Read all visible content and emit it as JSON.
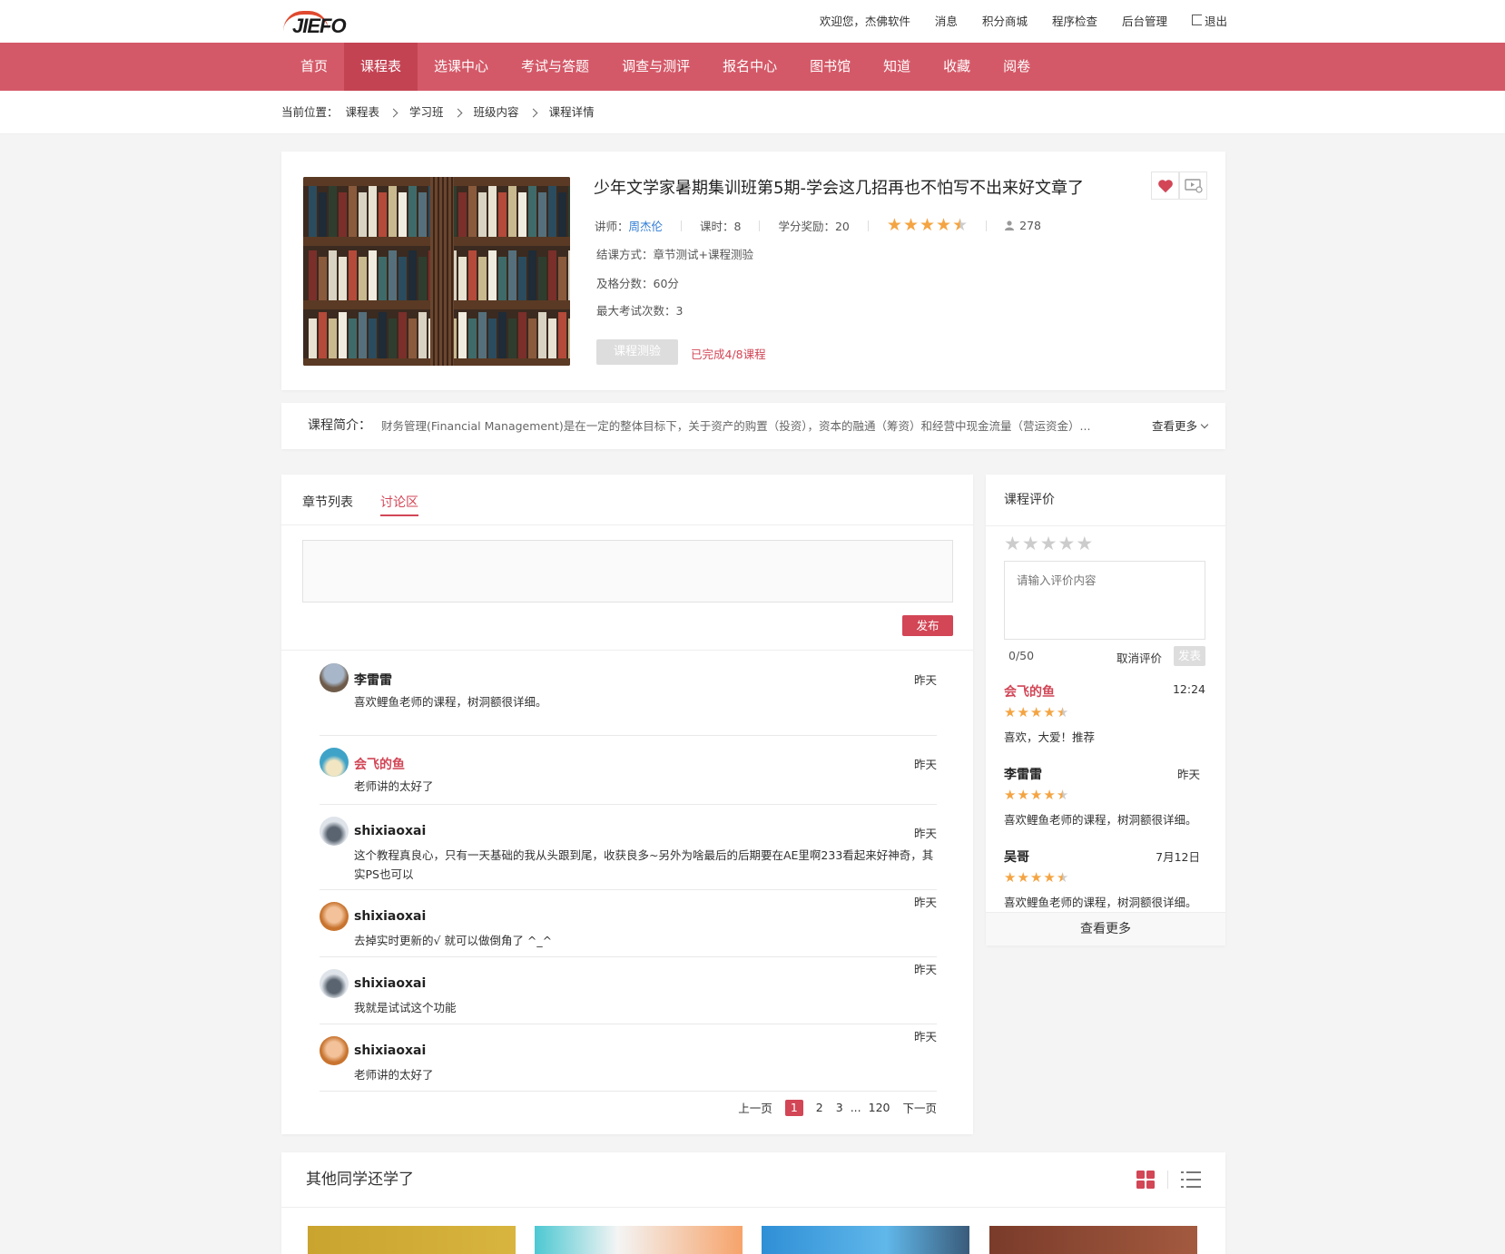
{
  "header": {
    "logo_text": "JIEFO",
    "welcome": "欢迎您，杰佛软件",
    "links": [
      "消息",
      "积分商城",
      "程序检查",
      "后台管理"
    ],
    "logout": "退出"
  },
  "nav": {
    "items": [
      "首页",
      "课程表",
      "选课中心",
      "考试与答题",
      "调查与测评",
      "报名中心",
      "图书馆",
      "知道",
      "收藏",
      "阅卷"
    ],
    "active_index": 1
  },
  "breadcrumb": {
    "label": "当前位置：",
    "items": [
      "课程表",
      "学习班",
      "班级内容",
      "课程详情"
    ]
  },
  "course": {
    "title": "少年文学家暑期集训班第5期-学会这几招再也不怕写不出来好文章了",
    "teacher_label": "讲师：",
    "teacher": "周杰伦",
    "hours": "课时：8",
    "credits": "学分奖励：20",
    "rating": 4.5,
    "learners": "278",
    "completion_mode": "结课方式：章节测试+课程测验",
    "pass_score": "及格分数：60分",
    "max_attempts": "最大考试次数：3",
    "test_button": "课程测验",
    "progress_text": "已完成4/8课程"
  },
  "intro": {
    "label": "课程简介：",
    "text": "财务管理(Financial Management)是在一定的整体目标下，关于资产的购置（投资），资本的融通（筹资）和经营中现金流量（营运资金）...",
    "more": "查看更多"
  },
  "discussion": {
    "tabs": [
      "章节列表",
      "讨论区"
    ],
    "active_tab": 1,
    "publish": "发布",
    "comments": [
      {
        "name": "李雷雷",
        "time": "昨天",
        "text": "喜欢鲤鱼老师的课程，树洞额很详细。",
        "highlight": false
      },
      {
        "name": "会飞的鱼",
        "time": "昨天",
        "text": "老师讲的太好了",
        "highlight": true
      },
      {
        "name": "shixiaoxai",
        "time": "昨天",
        "text": "这个教程真良心，只有一天基础的我从头跟到尾，收获良多~另外为啥最后的后期要在AE里啊233看起来好神奇，其实PS也可以",
        "highlight": false
      },
      {
        "name": "shixiaoxai",
        "time": "昨天",
        "text": "去掉实时更新的√ 就可以做倒角了 ^_^",
        "highlight": false
      },
      {
        "name": "shixiaoxai",
        "time": "昨天",
        "text": "我就是试试这个功能",
        "highlight": false
      },
      {
        "name": "shixiaoxai",
        "time": "昨天",
        "text": "老师讲的太好了",
        "highlight": false
      }
    ],
    "pager": {
      "prev": "上一页",
      "pages": [
        "1",
        "2",
        "3"
      ],
      "ellipsis": "...",
      "last": "120",
      "next": "下一页",
      "current": "1"
    }
  },
  "review": {
    "title": "课程评价",
    "placeholder": "请输入评价内容",
    "count": "0/50",
    "cancel": "取消评价",
    "submit": "发表",
    "items": [
      {
        "name": "会飞的鱼",
        "time": "12:24",
        "rating": 4.5,
        "text": "喜欢，大爱！推荐",
        "highlight": true
      },
      {
        "name": "李雷雷",
        "time": "昨天",
        "rating": 4.5,
        "text": "喜欢鲤鱼老师的课程，树洞额很详细。",
        "highlight": false
      },
      {
        "name": "吴哥",
        "time": "7月12日",
        "rating": 4.5,
        "text": "喜欢鲤鱼老师的课程，树洞额很详细。",
        "highlight": false
      }
    ],
    "more": "查看更多"
  },
  "others": {
    "title": "其他同学还学了"
  },
  "colors": {
    "brand": "#d45968",
    "accent": "#d24656",
    "star": "#f4a442",
    "link": "#2f7bd6"
  }
}
